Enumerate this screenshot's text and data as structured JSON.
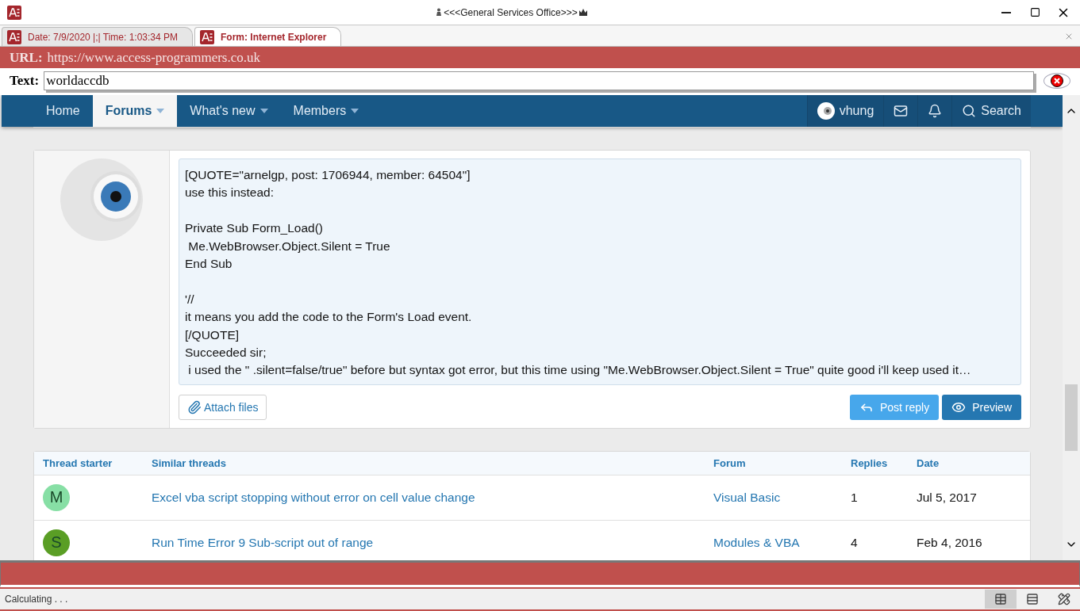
{
  "window": {
    "title": "<<<General Services Office>>>"
  },
  "tabs": [
    {
      "label": "Date: 7/9/2020 |;| Time: 1:03:34 PM",
      "selected": false
    },
    {
      "label": "Form: Internet Explorer",
      "selected": true
    }
  ],
  "url": {
    "label": "URL:",
    "value": "https://www.access-programmers.co.uk"
  },
  "text_field": {
    "label": "Text:",
    "value": "worldaccdb"
  },
  "nav": {
    "items": [
      {
        "label": "Home",
        "selected": false,
        "dropdown": false
      },
      {
        "label": "Forums",
        "selected": true,
        "dropdown": true
      },
      {
        "label": "What's new",
        "selected": false,
        "dropdown": true
      },
      {
        "label": "Members",
        "selected": false,
        "dropdown": true
      }
    ],
    "user": "vhung",
    "search": "Search"
  },
  "post": {
    "paragraphs": [
      [
        "[QUOTE=\"arnelgp, post: 1706944, member: 64504\"]",
        "use this instead:"
      ],
      [
        "Private Sub Form_Load()",
        " Me.WebBrowser.Object.Silent = True",
        "End Sub"
      ],
      [
        "'//",
        "it means you add the code to the Form's Load event.",
        "[/QUOTE]",
        "Succeeded sir;",
        " i used the \" .silent=false/true\" before but syntax got error, but this time using \"Me.WebBrowser.Object.Silent = True\" quite good i'll keep used it…"
      ]
    ],
    "attach": "Attach files",
    "buttons": [
      {
        "label": "Post reply",
        "kind": "reply"
      },
      {
        "label": "Preview",
        "kind": "preview"
      }
    ]
  },
  "similar": {
    "columns": [
      "Thread starter",
      "Similar threads",
      "Forum",
      "Replies",
      "Date"
    ],
    "rows": [
      {
        "initial": "M",
        "color": "#87dfa5",
        "title": "Excel vba script stopping without error on cell value change",
        "forum": "Visual Basic",
        "replies": "1",
        "date": "Jul 5, 2017"
      },
      {
        "initial": "S",
        "color": "#5a9e25",
        "title": "Run Time Error 9 Sub-script out of range",
        "forum": "Modules & VBA",
        "replies": "4",
        "date": "Feb 4, 2016"
      }
    ]
  },
  "status_bar": {
    "text": "Calculating . . .",
    "views": [
      {
        "selected": true
      },
      {
        "selected": false
      },
      {
        "selected": false
      }
    ]
  }
}
